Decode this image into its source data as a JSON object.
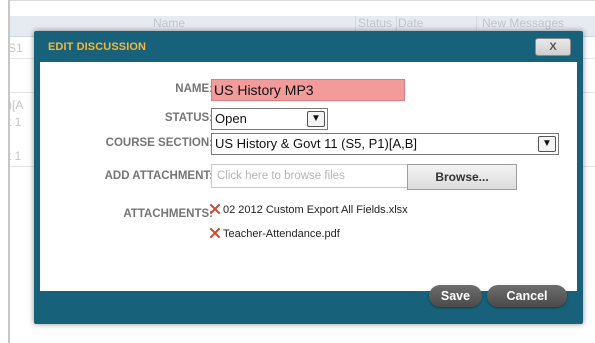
{
  "background": {
    "columns": [
      "Name",
      "Status",
      "Date",
      "New Messages"
    ],
    "row_fragments": [
      "S1",
      ")[A",
      "t 1",
      "t 1"
    ]
  },
  "dialog": {
    "title": "EDIT DISCUSSION",
    "close_label": "X",
    "fields": {
      "name_label": "NAME:",
      "name_value": "US History MP3",
      "status_label": "STATUS:",
      "status_value": "Open",
      "course_label": "COURSE SECTION:",
      "course_value": "US History & Govt 11 (S5, P1)[A,B]",
      "attachment_label": "ADD ATTACHMENT:",
      "attachment_placeholder": "Click here to browse files",
      "browse_label": "Browse...",
      "attachments_label": "ATTACHMENTS:"
    },
    "attachments": [
      {
        "filename": "02 2012 Custom Export All Fields.xlsx",
        "icon": "remove-x-icon"
      },
      {
        "filename": "Teacher-Attendance.pdf",
        "icon": "remove-x-icon"
      }
    ],
    "buttons": {
      "save_label": "Save",
      "cancel_label": "Cancel"
    },
    "colors": {
      "dialog_frame": "#17627a",
      "title_text": "#f4b83a",
      "required_field": "#f39b9b",
      "remove_icon": "#e0452e"
    }
  }
}
